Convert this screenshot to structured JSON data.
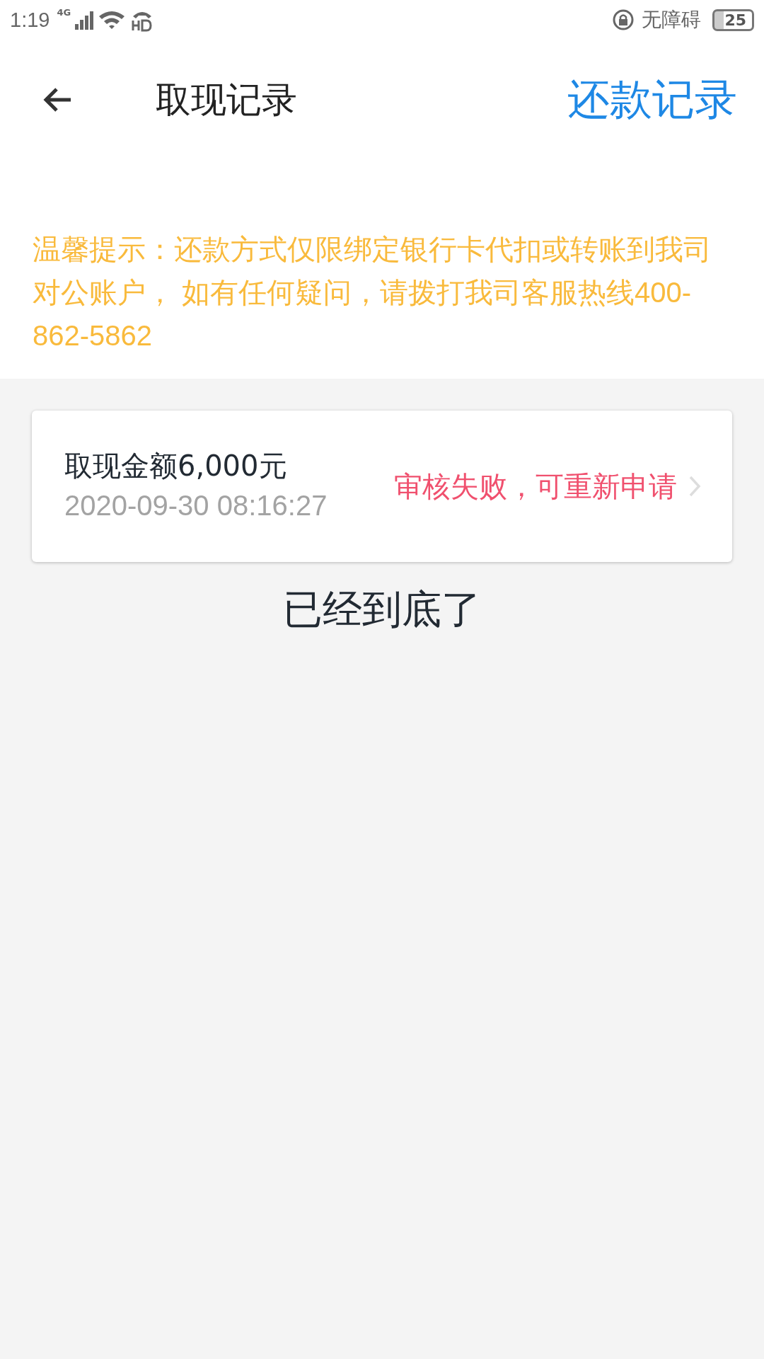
{
  "status_bar": {
    "time": "1:19",
    "network": "4G",
    "accessibility": "无障碍",
    "battery": "25"
  },
  "header": {
    "title": "取现记录",
    "action": "还款记录"
  },
  "notice": "温馨提示：还款方式仅限绑定银行卡代扣或转账到我司对公账户， 如有任何疑问，请拨打我司客服热线400-862-5862",
  "records": [
    {
      "amount": "取现金额6,000元",
      "time": "2020-09-30 08:16:27",
      "status": "审核失败，可重新申请",
      "color": "#f0506e"
    }
  ],
  "end_text": "已经到底了"
}
